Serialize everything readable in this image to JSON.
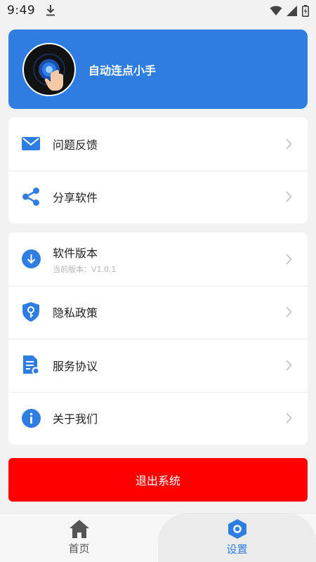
{
  "status_bar": {
    "time": "9:49",
    "icons": [
      "download-icon",
      "wifi-icon",
      "signal-icon",
      "battery-icon"
    ]
  },
  "profile": {
    "app_name": "自动连点小手",
    "logo_icon": "tap-target-logo",
    "background_color": "#2f7de1"
  },
  "group1": {
    "items": [
      {
        "label": "问题反馈",
        "icon": "mail-icon"
      },
      {
        "label": "分享软件",
        "icon": "share-icon"
      }
    ]
  },
  "group2": {
    "items": [
      {
        "label": "软件版本",
        "sublabel": "当前版本：V1.0.1",
        "icon": "download-circle-icon"
      },
      {
        "label": "隐私政策",
        "icon": "shield-key-icon"
      },
      {
        "label": "服务协议",
        "icon": "document-icon"
      },
      {
        "label": "关于我们",
        "icon": "info-icon"
      }
    ]
  },
  "logout": {
    "label": "退出系统",
    "color": "#ff0000"
  },
  "bottom_nav": {
    "items": [
      {
        "label": "首页",
        "icon": "home-icon",
        "active": false
      },
      {
        "label": "设置",
        "icon": "settings-hex-icon",
        "active": true
      }
    ],
    "active_color": "#2f7de1"
  }
}
